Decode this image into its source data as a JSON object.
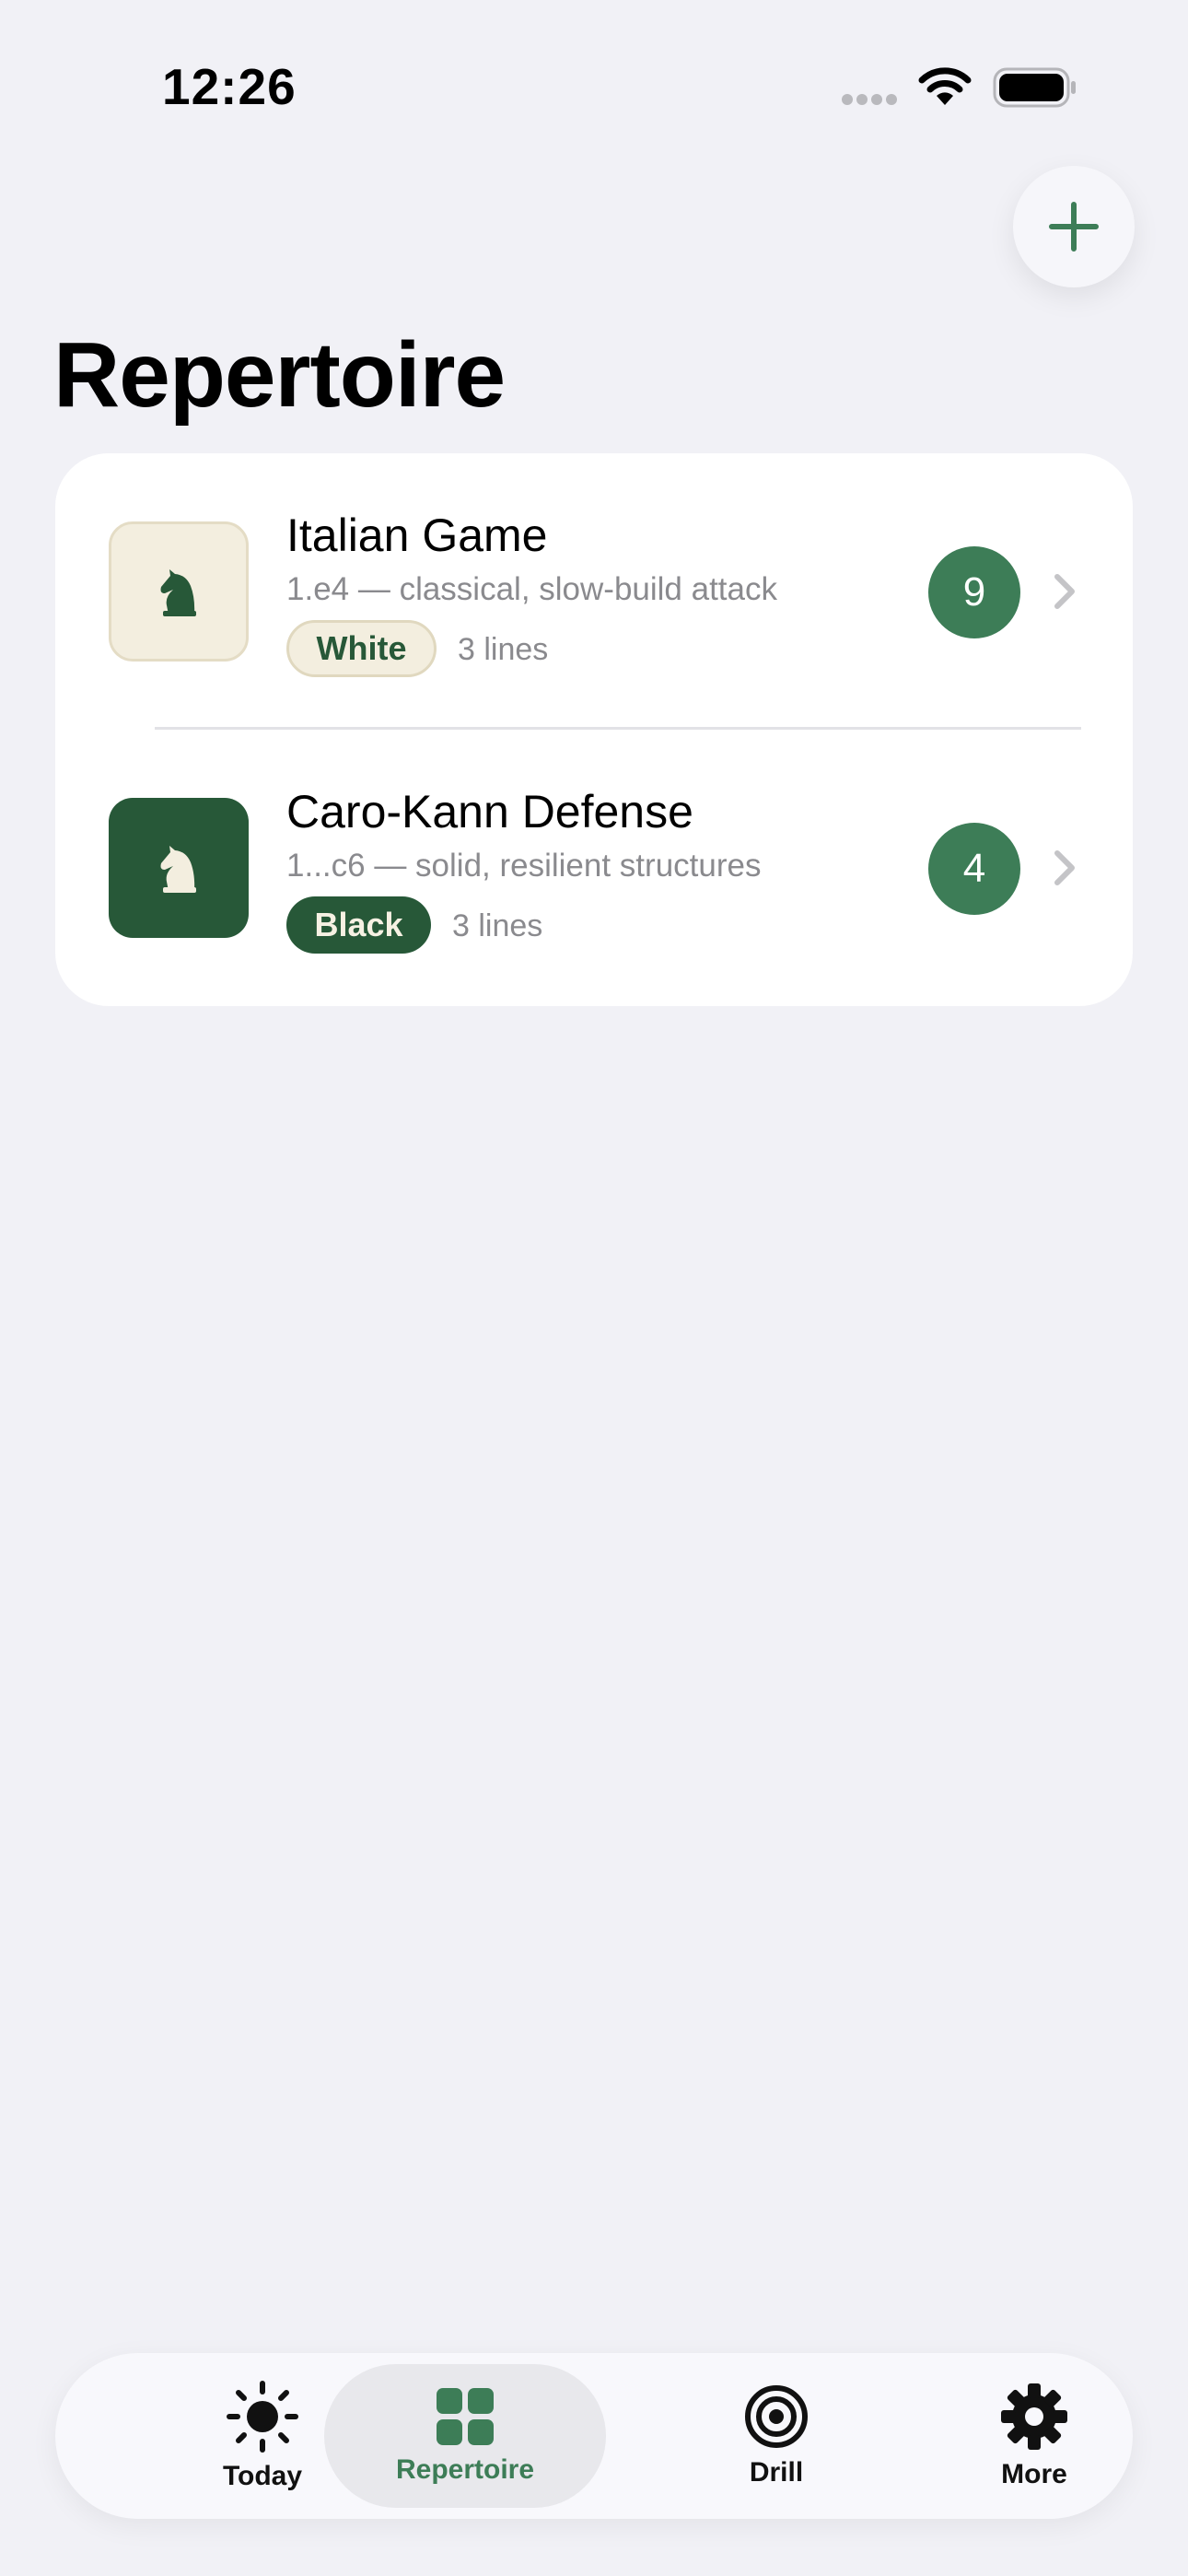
{
  "status_bar": {
    "time": "12:26"
  },
  "header": {
    "title": "Repertoire",
    "add_icon": "plus-icon"
  },
  "openings": [
    {
      "name": "Italian Game",
      "subtitle": "1.e4 — classical, slow-build attack",
      "side": "White",
      "lines": "3 lines",
      "count": "9",
      "icon": "knight-icon"
    },
    {
      "name": "Caro-Kann Defense",
      "subtitle": "1...c6 — solid, resilient structures",
      "side": "Black",
      "lines": "3 lines",
      "count": "4",
      "icon": "knight-icon"
    }
  ],
  "tabs": [
    {
      "label": "Today",
      "icon": "sun-icon"
    },
    {
      "label": "Repertoire",
      "icon": "grid-icon",
      "active": true
    },
    {
      "label": "Drill",
      "icon": "target-icon"
    },
    {
      "label": "More",
      "icon": "gear-icon"
    }
  ],
  "colors": {
    "accent": "#3d7d57",
    "dark_green": "#275838",
    "cream": "#f3eedf",
    "background": "#f1f1f6"
  }
}
